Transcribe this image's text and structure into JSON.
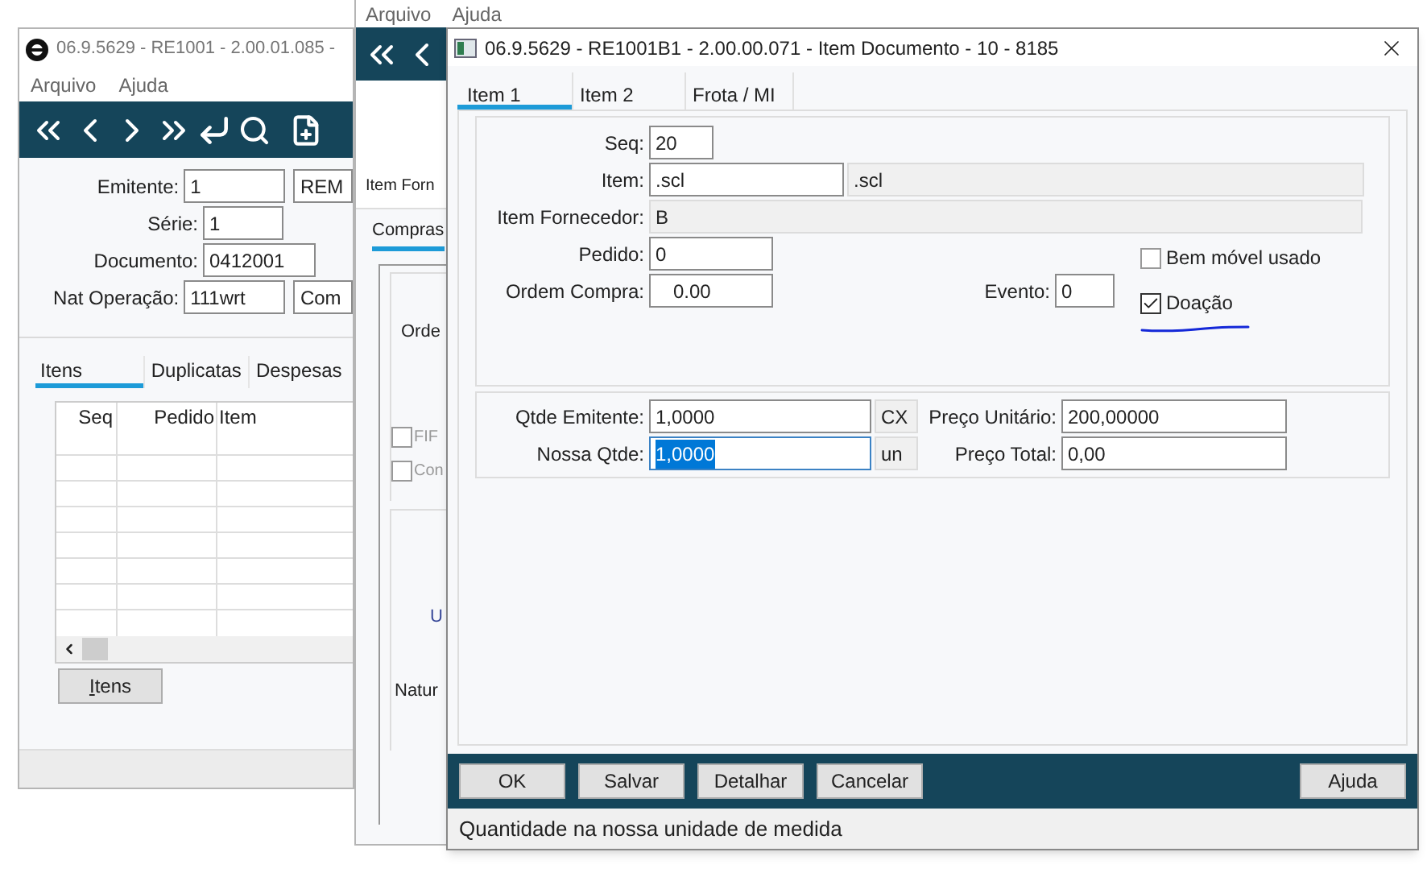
{
  "back_window": {
    "title": "06.9.5629 - RE1001 - 2.00.01.085 -",
    "menu": [
      "Arquivo",
      "Ajuda"
    ],
    "fields": [
      {
        "label": "Emitente:",
        "value": "1",
        "extra": "REM"
      },
      {
        "label": "Série:",
        "value": "1"
      },
      {
        "label": "Documento:",
        "value": "0412001"
      },
      {
        "label": "Nat Operação:",
        "value": "111wrt",
        "extra": "Com"
      }
    ],
    "tabs": [
      {
        "label": "Itens",
        "selected": true
      },
      {
        "label": "Duplicatas",
        "selected": false
      },
      {
        "label": "Despesas",
        "selected": false
      }
    ],
    "table": {
      "columns": [
        "Seq",
        "Pedido",
        "Item"
      ]
    },
    "button": "Itens"
  },
  "middle_window": {
    "menu": [
      "Arquivo",
      "Ajuda"
    ],
    "label_1": "Item Forn",
    "tab": {
      "label": "Compras",
      "selected": true
    },
    "label_2": "Orde",
    "checkboxes": [
      {
        "label": "FIF",
        "checked": false
      },
      {
        "label": "Con",
        "checked": false
      }
    ],
    "label_3": "U",
    "label_4": "Natur"
  },
  "dialog": {
    "title": "06.9.5629 - RE1001B1 - 2.00.00.071 - Item Documento - 10 - 8185",
    "tabs": [
      {
        "label": "Item 1",
        "selected": true
      },
      {
        "label": "Item 2",
        "selected": false
      },
      {
        "label": "Frota / MI",
        "selected": false
      }
    ],
    "seq": {
      "label": "Seq:",
      "value": "20"
    },
    "item": {
      "label": "Item:",
      "value": ".scl",
      "description": ".scl"
    },
    "item_fornecedor": {
      "label": "Item Fornecedor:",
      "value": "B"
    },
    "pedido": {
      "label": "Pedido:",
      "value": "0"
    },
    "ordem_compra": {
      "label": "Ordem Compra:",
      "value": "0.00"
    },
    "evento": {
      "label": "Evento:",
      "value": "0"
    },
    "checkboxes": [
      {
        "label": "Bem móvel usado",
        "checked": false
      },
      {
        "label": "Doação",
        "checked": true
      }
    ],
    "quantities": [
      {
        "label": "Qtde Emitente:",
        "value": "1,0000",
        "unit": "CX",
        "focused": false,
        "price_label": "Preço Unitário:",
        "price": "200,00000"
      },
      {
        "label": "Nossa Qtde:",
        "value": "1,0000",
        "unit": "un",
        "focused": true,
        "price_label": "Preço Total:",
        "price": "0,00"
      }
    ],
    "buttons": [
      "OK",
      "Salvar",
      "Detalhar",
      "Cancelar"
    ],
    "help_button": "Ajuda",
    "status_bar": "Quantidade na nossa unidade de medida"
  }
}
